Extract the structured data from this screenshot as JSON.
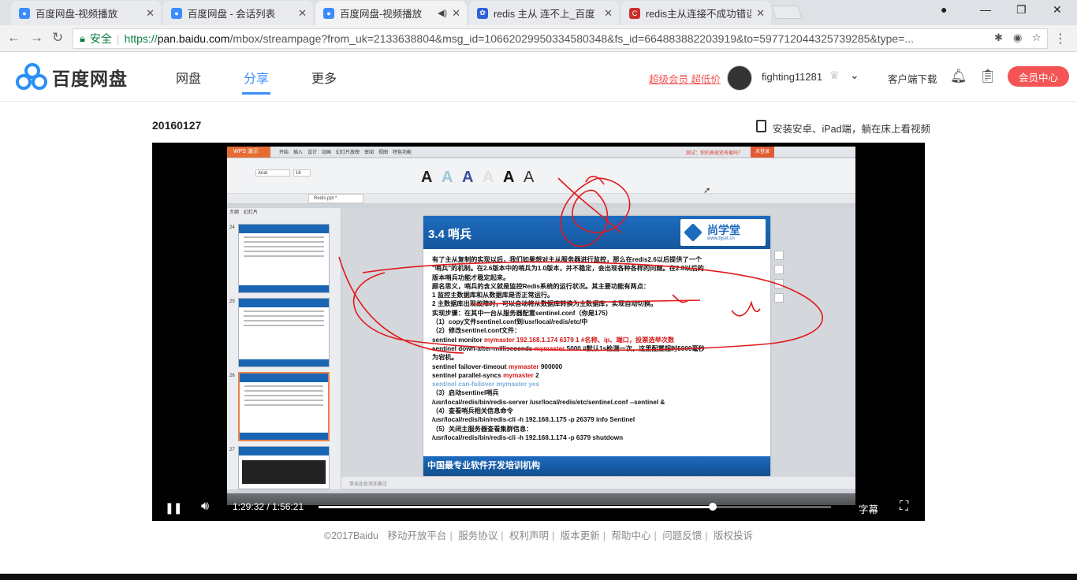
{
  "browser": {
    "tabs": [
      {
        "title": "百度网盘-视频播放",
        "favicon_color": "#3b8cff"
      },
      {
        "title": "百度网盘 - 会话列表",
        "favicon_color": "#3b8cff"
      },
      {
        "title": "百度网盘-视频播放",
        "favicon_color": "#3b8cff",
        "active": true
      },
      {
        "title": "redis 主从 连不上_百度",
        "favicon_color": "#2d63d8"
      },
      {
        "title": "redis主从连接不成功错误",
        "favicon_color": "#c9302c"
      }
    ],
    "secure_label": "安全",
    "url_scheme": "https://",
    "url_host": "pan.baidu.com",
    "url_rest": "/mbox/streampage?from_uk=2133638804&msg_id=10662029950334580348&fs_id=664883882203919&to=597712044325739285&type=..."
  },
  "header": {
    "logo_text": "百度网盘",
    "nav": [
      "网盘",
      "分享",
      "更多"
    ],
    "promo": "超级会员 超低价",
    "username": "fighting11281",
    "client_download": "客户端下载",
    "vip_button": "会员中心"
  },
  "video": {
    "title": "20160127",
    "mobile_hint": "安装安卓、iPad端，躺在床上看视频",
    "current_time": "1:29:32",
    "separator": "/",
    "duration": "1:56:21",
    "progress": 0.7695,
    "subtitle_label": "字幕"
  },
  "wps": {
    "app_label": "WPS 演示",
    "menu_tabs": "开始　插入　设计　动画　幻灯片放映　审阅　视图　特色功能",
    "hint": "测试：你的表现还有截吗？",
    "login": "未登录",
    "font": "Arial",
    "size": "16",
    "file_tab": "Redis.ppt *",
    "panel_header": "大纲　幻灯片",
    "note_hint": "单击此处添加备注"
  },
  "slide": {
    "title": "3.4 哨兵",
    "brand": "尚学堂",
    "brand_url": "www.bjsxt.cn",
    "footer": "中国最专业软件开发培训机构",
    "lines": [
      {
        "text": "有了主从复制的实现以后，我们如果想对主从服务器进行监控，那么在redis2.6以后提供了一个",
        "style": ""
      },
      {
        "text": "\"哨兵\"的机制。在2.6版本中的哨兵为1.0版本，并不稳定，会出现各种各样的问题。在2.8以后的",
        "style": ""
      },
      {
        "text": "版本哨兵功能才稳定起来。",
        "style": ""
      },
      {
        "text": "顾名思义，哨兵的含义就是监控Redis系统的运行状况。其主要功能有两点：",
        "style": ""
      },
      {
        "text": "1 监控主数据库和从数据库是否正常运行。",
        "style": ""
      },
      {
        "text": "2 主数据库出现故障时，可以自动将从数据库转换为主数据库，实现自动切换。",
        "style": ""
      },
      {
        "text": "实现步骤：在其中一台从服务器配置sentinel.conf（你是175）",
        "style": ""
      },
      {
        "text": "（1）copy文件sentinel.conf到/usr/local/redis/etc/中",
        "style": ""
      },
      {
        "text": "（2）修改sentinel.conf文件：",
        "style": ""
      },
      {
        "text": "sentinel monitor mymaster 192.168.1.174 6379 1 #名称、ip、端口，投票选举次数",
        "style": "mix1"
      },
      {
        "text": "sentinel down-after-milliseconds mymaster 5000 #默认1s检测一次，这里配置超时5000毫秒",
        "style": "mix2"
      },
      {
        "text": "为宕机。",
        "style": ""
      },
      {
        "text": "sentinel failover-timeout mymaster 900000",
        "style": "mix3"
      },
      {
        "text": "sentinel parallel-syncs mymaster 2",
        "style": "mix4"
      },
      {
        "text": "sentinel can-failover mymaster yes",
        "style": "faded"
      },
      {
        "text": "（3）启动sentinel哨兵",
        "style": ""
      },
      {
        "text": "/usr/local/redis/bin/redis-server /usr/local/redis/etc/sentinel.conf --sentinel &",
        "style": ""
      },
      {
        "text": "（4）查看哨兵相关信息命令",
        "style": ""
      },
      {
        "text": "/usr/local/redis/bin/redis-cli -h 192.168.1.175 -p 26379 info Sentinel",
        "style": ""
      },
      {
        "text": "（5）关闭主服务器查看集群信息：",
        "style": ""
      },
      {
        "text": "/usr/local/redis/bin/redis-cli -h 192.168.1.174 -p 6379 shutdown",
        "style": ""
      }
    ],
    "mix": {
      "m1a": "sentinel monitor ",
      "m1b": "mymaster 192.168.1.174 6379 1 #名称、ip、端口，投票选举次数",
      "m2a": "sentinel down-after-milliseconds ",
      "m2b": "mymaster",
      "m2c": " 5000 #默认1s检测一次，这里配置超时5000毫秒",
      "m3a": "sentinel failover-timeout ",
      "m3b": "mymaster",
      "m3c": " 900000",
      "m4a": "sentinel parallel-syncs ",
      "m4b": "mymaster",
      "m4c": " 2"
    }
  },
  "footer": {
    "copyright": "©2017Baidu",
    "links": [
      "移动开放平台",
      "服务协议",
      "权利声明",
      "版本更新",
      "帮助中心",
      "问题反馈",
      "版权投诉"
    ]
  }
}
